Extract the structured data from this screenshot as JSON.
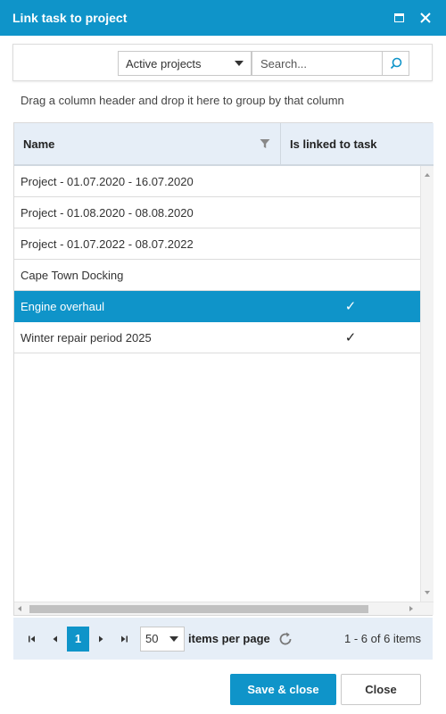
{
  "dialog": {
    "title": "Link task to project",
    "accent_color": "#0f94c9"
  },
  "toolbar": {
    "filter_value": "Active projects",
    "search_placeholder": "Search..."
  },
  "grid": {
    "group_hint": "Drag a column header and drop it here to group by that column",
    "columns": [
      "Name",
      "Is linked to task"
    ],
    "rows": [
      {
        "name": "Project - 01.07.2020 - 16.07.2020",
        "linked": ""
      },
      {
        "name": "Project - 01.08.2020 - 08.08.2020",
        "linked": ""
      },
      {
        "name": "Project - 01.07.2022 - 08.07.2022",
        "linked": ""
      },
      {
        "name": "Cape Town Docking",
        "linked": ""
      },
      {
        "name": "Engine overhaul",
        "linked": "✓",
        "selected": true
      },
      {
        "name": "Winter repair period 2025",
        "linked": "✓"
      }
    ]
  },
  "pager": {
    "current_page": "1",
    "page_size": "50",
    "per_page_label": "items per page",
    "info": "1 - 6 of 6 items"
  },
  "footer": {
    "save_label": "Save & close",
    "close_label": "Close"
  }
}
